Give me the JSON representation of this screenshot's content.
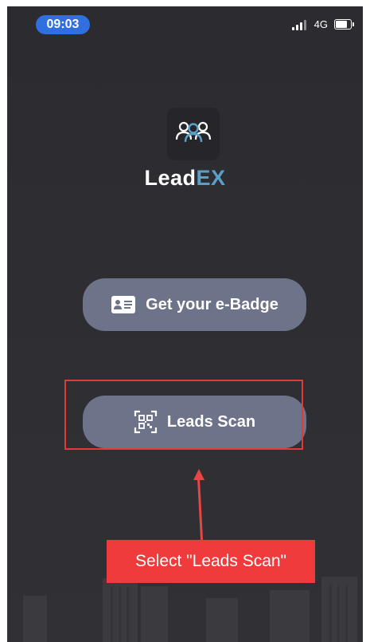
{
  "status_bar": {
    "time": "09:03",
    "network": "4G"
  },
  "app": {
    "logo_prefix": "Lead",
    "logo_accent": "EX"
  },
  "buttons": {
    "badge_label": "Get your e-Badge",
    "scan_label": "Leads Scan"
  },
  "annotation": {
    "callout_text": "Select \"Leads Scan\""
  },
  "colors": {
    "background": "#2e2e32",
    "button": "#6d7389",
    "accent": "#5aa0c8",
    "annotation_red": "#ef3b3b",
    "time_pill": "#2f6fe0"
  }
}
